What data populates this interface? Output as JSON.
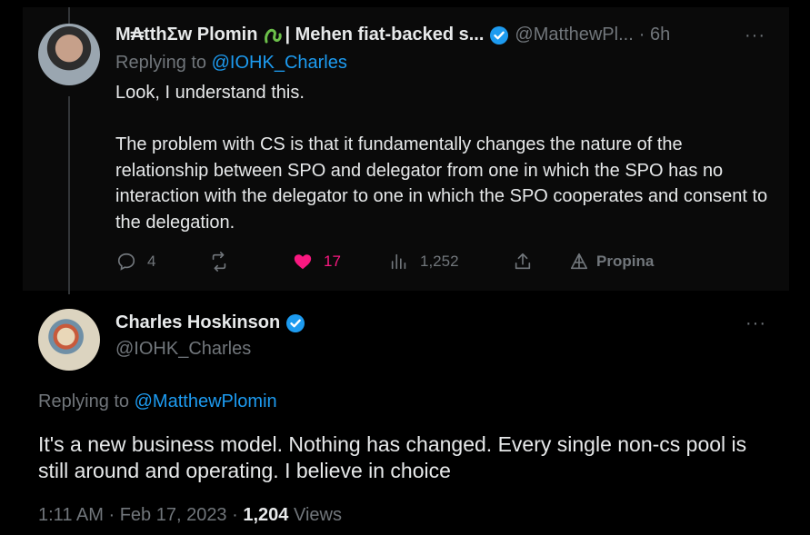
{
  "tweet1": {
    "name": "M₳tthΣw Plomin",
    "name_suffix": "| Mehen fiat-backed s...",
    "handle": "@MatthewPl...",
    "time": "· 6h",
    "more": "···",
    "replying_label": "Replying to ",
    "replying_handle": "@IOHK_Charles",
    "body": "Look, I understand this.\n\nThe problem with CS is that it fundamentally changes the nature of the relationship between SPO and delegator from one in which the SPO has no interaction with the delegator to one in which the SPO cooperates and consent to the delegation.",
    "replies": "4",
    "retweets": "",
    "likes": "17",
    "views": "1,252",
    "tip_label": "Propina"
  },
  "tweet2": {
    "name": "Charles Hoskinson",
    "handle": "@IOHK_Charles",
    "more": "···",
    "replying_label": "Replying to ",
    "replying_handle": "@MatthewPlomin",
    "body": "It's a new business model. Nothing has changed. Every single non-cs pool is still around and operating. I believe in choice",
    "time": "1:11 AM",
    "date": "Feb 17, 2023",
    "views_count": "1,204",
    "views_label": "Views"
  },
  "colors": {
    "background": "#000000",
    "text": "#e7e9ea",
    "secondary": "#71767b",
    "link": "#1d9bf0",
    "like": "#f91880",
    "verified": "#1d9bf0"
  }
}
